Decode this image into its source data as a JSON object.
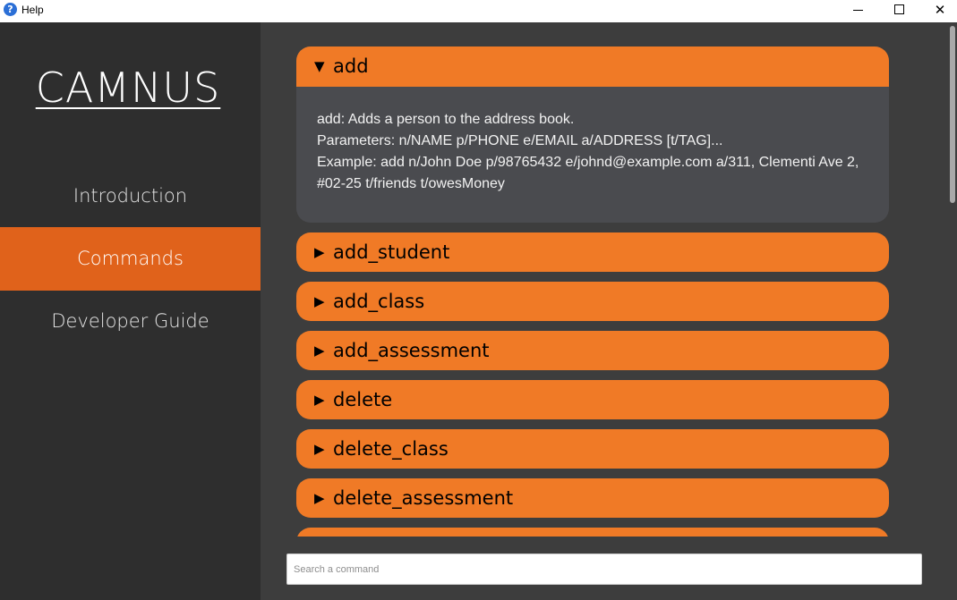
{
  "window": {
    "title": "Help",
    "app_icon_glyph": "?",
    "close_glyph": "✕"
  },
  "colors": {
    "accent": "#f07a26",
    "nav_active": "#e0621b",
    "sidebar_bg": "#2e2e2e",
    "main_bg": "#3d3d3d",
    "expanded_bg": "#4a4b4f"
  },
  "sidebar": {
    "brand": "CAMNUS",
    "items": [
      {
        "label": "Introduction",
        "active": false
      },
      {
        "label": "Commands",
        "active": true
      },
      {
        "label": "Developer Guide",
        "active": false
      }
    ]
  },
  "commands": {
    "expanded_arrow": "▼",
    "collapsed_arrow": "▶",
    "items": [
      {
        "name": "add",
        "expanded": true,
        "details": [
          "add: Adds a person to the address book.",
          "Parameters: n/NAME p/PHONE e/EMAIL a/ADDRESS [t/TAG]...",
          "Example: add n/John Doe p/98765432 e/johnd@example.com a/311, Clementi Ave 2, #02-25 t/friends t/owesMoney"
        ]
      },
      {
        "name": "add_student",
        "expanded": false
      },
      {
        "name": "add_class",
        "expanded": false
      },
      {
        "name": "add_assessment",
        "expanded": false
      },
      {
        "name": "delete",
        "expanded": false
      },
      {
        "name": "delete_class",
        "expanded": false
      },
      {
        "name": "delete_assessment",
        "expanded": false
      }
    ]
  },
  "search": {
    "placeholder": "Search a command",
    "value": ""
  }
}
